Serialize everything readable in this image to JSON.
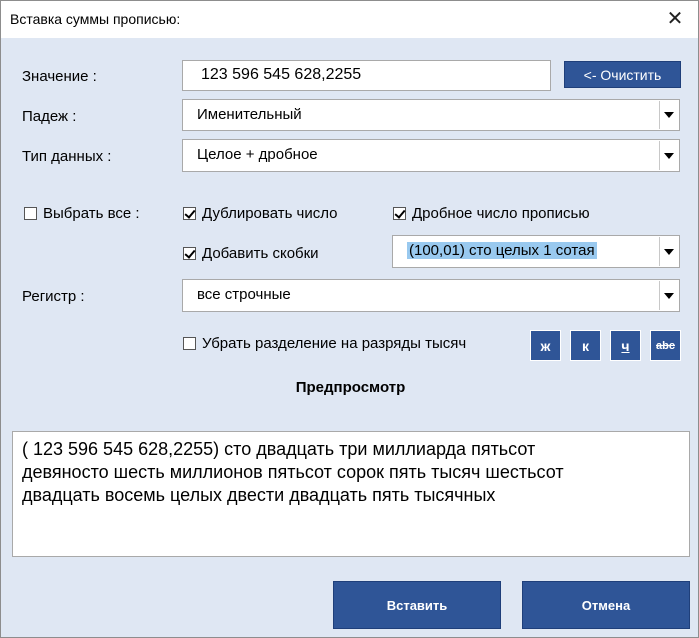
{
  "window": {
    "title": "Вставка суммы прописью:",
    "close_glyph": "✕"
  },
  "value": {
    "label": "Значение :",
    "text": "123 596 545 628,2255",
    "clear_label": "<- Очистить"
  },
  "case": {
    "label": "Падеж :",
    "selected": "Именительный"
  },
  "datatype": {
    "label": "Тип данных :",
    "selected": "Целое + дробное"
  },
  "options": {
    "select_all": "Выбрать все :",
    "duplicate": "Дублировать число",
    "fraction_words": "Дробное число прописью",
    "brackets": "Добавить скобки",
    "fraction_format": "(100,01) сто целых 1 сотая",
    "no_separators": "Убрать разделение на разряды тысяч"
  },
  "register": {
    "label": "Регистр :",
    "selected": "все строчные"
  },
  "format_buttons": {
    "bold": "ж",
    "italic": "к",
    "underline": "ч",
    "strike": "abc"
  },
  "preview": {
    "heading": "Предпросмотр",
    "line1": "( 123 596 545 628,2255) сто двадцать три миллиарда пятьсот",
    "line2": "девяносто шесть миллионов пятьсот сорок пять тысяч шестьсот",
    "line3": "двадцать восемь  целых двести двадцать пять тысячных"
  },
  "actions": {
    "insert": "Вставить",
    "cancel": "Отмена"
  },
  "colors": {
    "accent": "#2f5597",
    "background": "#dfe7f3",
    "highlight": "#99c9ef"
  }
}
